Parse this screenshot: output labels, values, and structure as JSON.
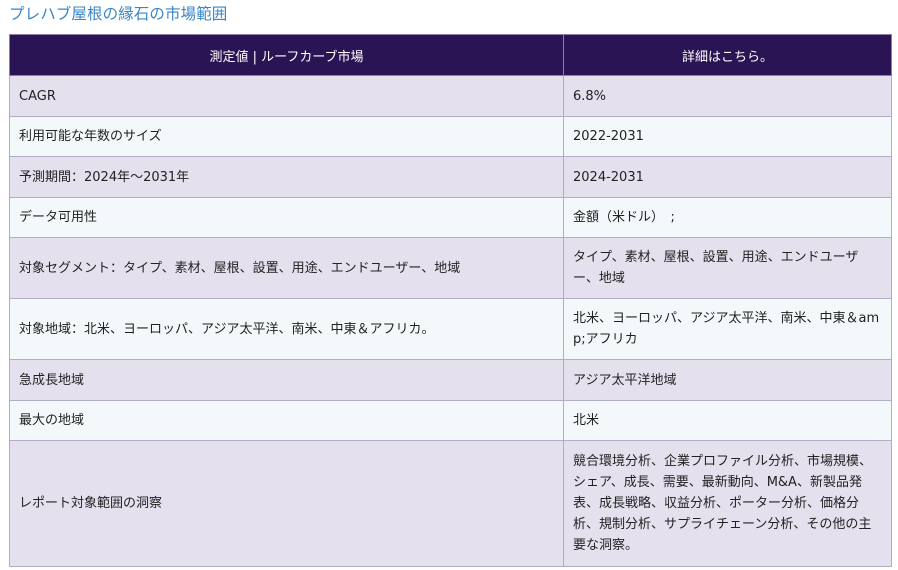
{
  "page": {
    "title": "プレハブ屋根の縁石の市場範囲"
  },
  "table": {
    "headers": [
      "測定値 | ルーフカーブ市場",
      "詳細はこちら。"
    ],
    "rows": [
      [
        "CAGR",
        "6.8%"
      ],
      [
        "利用可能な年数のサイズ",
        "2022-2031"
      ],
      [
        "予測期間：2024年～2031年",
        "2024-2031"
      ],
      [
        "データ可用性",
        "金額（米ドル）　;"
      ],
      [
        "対象セグメント：タイプ、素材、屋根、設置、用途、エンドユーザー、地域",
        "タイプ、素材、屋根、設置、用途、エンドユーザー、地域"
      ],
      [
        "対象地域：北米、ヨーロッパ、アジア太平洋、南米、中東＆アフリカ。",
        "北米、ヨーロッパ、アジア太平洋、南米、中東＆amp;アフリカ"
      ],
      [
        "急成長地域",
        "アジア太平洋地域"
      ],
      [
        "最大の地域",
        "北米"
      ],
      [
        "レポート対象範囲の洞察",
        "競合環境分析、企業プロファイル分析、市場規模、シェア、成長、需要、最新動向、M&A、新製品発表、成長戦略、収益分析、ポーター分析、価格分析、規制分析、サプライチェーン分析、その他の主要な洞察。"
      ]
    ]
  }
}
